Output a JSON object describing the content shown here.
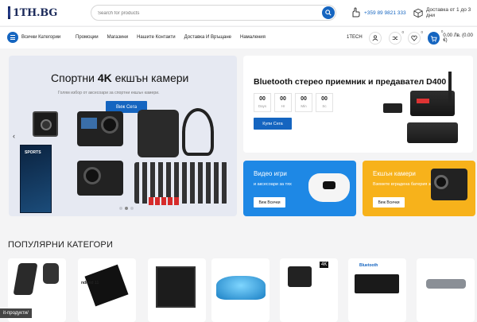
{
  "header": {
    "logo_text": "1TH.BG",
    "search_placeholder": "Search for products",
    "phone": "+359 89 9821 333",
    "shipping": "Доставка от 1 до 3 дни"
  },
  "nav": {
    "categories_label": "Всички Категории",
    "menu": [
      "Промоции",
      "Магазини",
      "Нашите Контакти",
      "Доставка И Връщане",
      "Намаления"
    ],
    "brand": "1TECH",
    "compare_count": "0",
    "wishlist_count": "0",
    "cart_count": "0",
    "cart_total": "0.00 Лв. (0.00 €)"
  },
  "hero": {
    "title_prefix": "Спортни ",
    "title_bold": "4K",
    "title_suffix": " екшън камери",
    "subtitle": "Голям избор от аксесоари за спортни екшън камери.",
    "button": "Виж Сега",
    "prev_arrow": "‹",
    "box_label": "SPORTS"
  },
  "promo_bluetooth": {
    "title": "Bluetooth стерео приемник и предавател D400",
    "timer": [
      {
        "value": "00",
        "label": "Days"
      },
      {
        "value": "00",
        "label": "Hr"
      },
      {
        "value": "00",
        "label": "Min"
      },
      {
        "value": "00",
        "label": "Sc"
      }
    ],
    "button": "Купи Сега"
  },
  "promo_games": {
    "title": "Видео игри",
    "subtitle": "и аксесоари за тях",
    "button": "Виж Всички"
  },
  "promo_action": {
    "title": "Екшън камери",
    "subtitle": "Вземете вградена батерия за...",
    "button": "Виж Всички"
  },
  "popular": {
    "title": "ПОПУЛЯРНИ КАТЕГОРИ",
    "tile_labels": [
      "ndroid 11",
      "Bluetooth",
      "4K"
    ]
  },
  "status_tip": "it-продукти/",
  "colors": {
    "primary": "#1565c0",
    "games_card": "#1e88e5",
    "action_card": "#f7b21b"
  }
}
